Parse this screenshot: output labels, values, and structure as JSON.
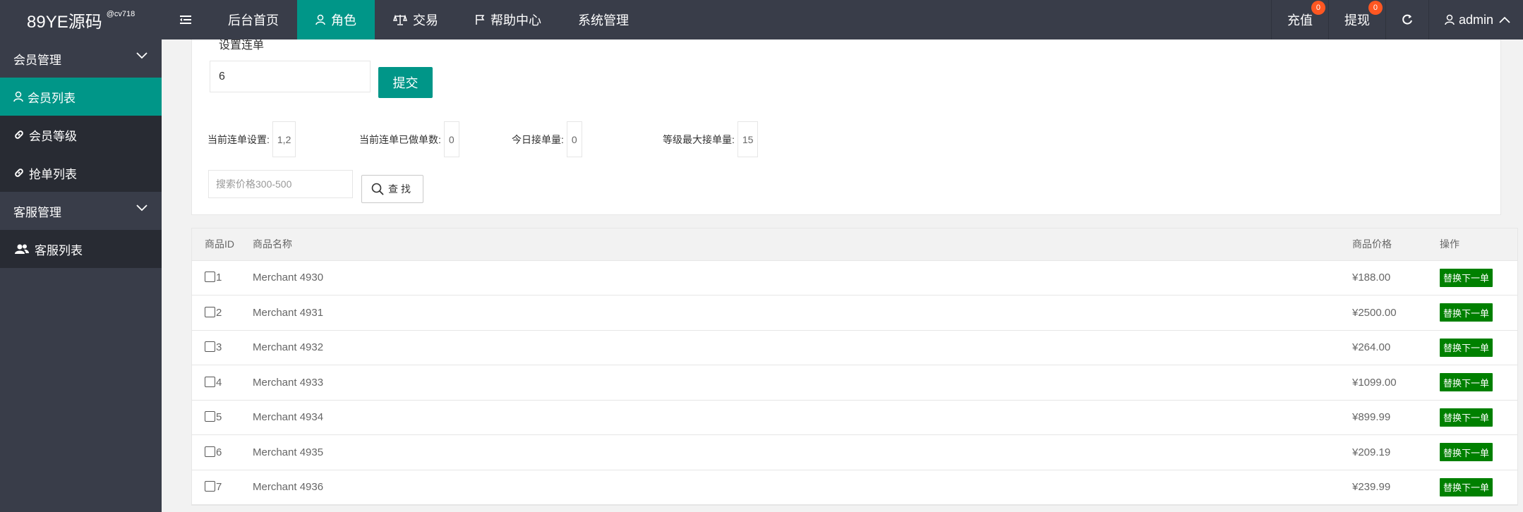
{
  "header": {
    "logo": "89YE源码",
    "logo_sub": "@cv718",
    "nav": [
      {
        "label": "后台首页"
      },
      {
        "label": "角色"
      },
      {
        "label": "交易"
      },
      {
        "label": "帮助中心"
      },
      {
        "label": "系统管理"
      }
    ],
    "recharge_label": "充值",
    "recharge_count": "0",
    "withdraw_label": "提现",
    "withdraw_count": "0",
    "user": "admin"
  },
  "sidebar": {
    "groups": [
      {
        "label": "会员管理",
        "items": [
          {
            "label": "会员列表"
          },
          {
            "label": "会员等级"
          },
          {
            "label": "抢单列表"
          }
        ]
      },
      {
        "label": "客服管理",
        "items": [
          {
            "label": "客服列表"
          }
        ]
      }
    ]
  },
  "form": {
    "legend": "设置连单",
    "lian_value": "6",
    "submit_label": "提交",
    "stats": [
      {
        "label": "当前连单设置:",
        "value": "1,2"
      },
      {
        "label": "当前连单已做单数:",
        "value": "0"
      },
      {
        "label": "今日接单量:",
        "value": "0"
      },
      {
        "label": "等级最大接单量:",
        "value": "15"
      }
    ],
    "search_placeholder": "搜索价格300-500",
    "search_label": "查找"
  },
  "table": {
    "headers": {
      "id": "商品ID",
      "name": "商品名称",
      "price": "商品价格",
      "op": "操作"
    },
    "action_label": "替换下一单",
    "rows": [
      {
        "id": "1",
        "name": "Merchant 4930",
        "price": "¥188.00"
      },
      {
        "id": "2",
        "name": "Merchant 4931",
        "price": "¥2500.00"
      },
      {
        "id": "3",
        "name": "Merchant 4932",
        "price": "¥264.00"
      },
      {
        "id": "4",
        "name": "Merchant 4933",
        "price": "¥1099.00"
      },
      {
        "id": "5",
        "name": "Merchant 4934",
        "price": "¥899.99"
      },
      {
        "id": "6",
        "name": "Merchant 4935",
        "price": "¥209.19"
      },
      {
        "id": "7",
        "name": "Merchant 4936",
        "price": "¥239.99"
      }
    ]
  },
  "colors": {
    "topbar": "#393d49",
    "accent": "#009688",
    "sidebar_item": "#282b33",
    "action_green": "#008000",
    "badge": "#ff5722"
  }
}
